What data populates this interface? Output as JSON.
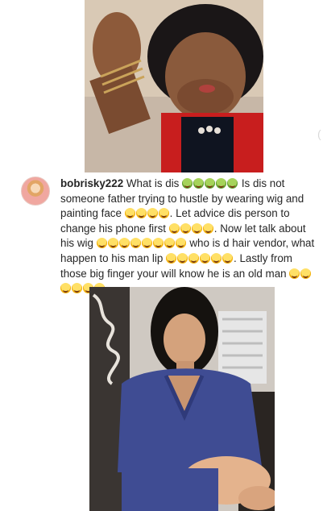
{
  "comment": {
    "username": "bobrisky222",
    "segments": [
      {
        "type": "text",
        "value": " What is dis "
      },
      {
        "type": "emoji",
        "name": "green-nauseated-face",
        "count": 5
      },
      {
        "type": "text",
        "value": " Is dis not someone father trying to hustle by wearing wig and painting face "
      },
      {
        "type": "emoji",
        "name": "grinning-sweat-face",
        "count": 4
      },
      {
        "type": "text",
        "value": ". Let advice dis person to change his phone first "
      },
      {
        "type": "emoji",
        "name": "grinning-sweat-face",
        "count": 4
      },
      {
        "type": "text",
        "value": ". Now let talk about his wig "
      },
      {
        "type": "emoji",
        "name": "grinning-sweat-face",
        "count": 8
      },
      {
        "type": "text",
        "value": " who is d hair vendor, what happen to his man lip "
      },
      {
        "type": "emoji",
        "name": "grinning-sweat-face",
        "count": 6
      },
      {
        "type": "text",
        "value": ". Lastly from those big finger your will know he is an old man "
      },
      {
        "type": "emoji",
        "name": "grinning-sweat-face",
        "count": 6
      }
    ]
  },
  "icons": {
    "avatar": "profile-avatar",
    "side_mark": "partial-overlay-icon"
  },
  "side_mark_glyph": "("
}
